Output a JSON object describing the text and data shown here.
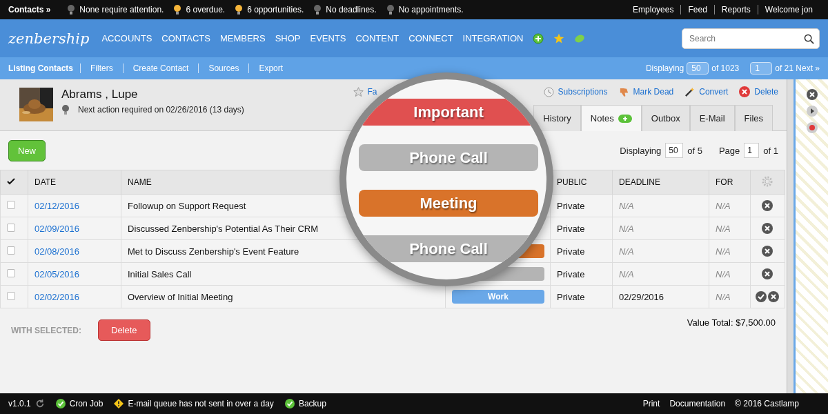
{
  "top_bar": {
    "title": "Contacts »",
    "notices": [
      {
        "text": "None require attention.",
        "lit": false
      },
      {
        "text": "6 overdue.",
        "lit": true
      },
      {
        "text": "6 opportunities.",
        "lit": true
      },
      {
        "text": "No deadlines.",
        "lit": false
      },
      {
        "text": "No appointments.",
        "lit": false
      }
    ],
    "links": [
      "Employees",
      "Feed",
      "Reports",
      "Welcome jon"
    ]
  },
  "nav": {
    "logo": "zenbership",
    "items": [
      "ACCOUNTS",
      "CONTACTS",
      "MEMBERS",
      "SHOP",
      "EVENTS",
      "CONTENT",
      "CONNECT",
      "INTEGRATION"
    ],
    "search": {
      "placeholder": "Search"
    }
  },
  "sub_bar": {
    "title": "Listing Contacts",
    "links": [
      "Filters",
      "Create Contact",
      "Sources",
      "Export"
    ],
    "displaying_label": "Displaying",
    "per_page": "50",
    "total": "of 1023",
    "page": "1",
    "pages": "of 21 Next »"
  },
  "contact": {
    "name": "Abrams , Lupe",
    "next_action": "Next action required on 02/26/2016 (13 days)",
    "actions": [
      {
        "kind": "star",
        "label": "Fa"
      },
      {
        "kind": "clock",
        "label": "Subscriptions"
      },
      {
        "kind": "thumb",
        "label": "Mark Dead"
      },
      {
        "kind": "wand",
        "label": "Convert"
      },
      {
        "kind": "delete",
        "label": "Delete"
      }
    ],
    "tabs": [
      {
        "label": "History",
        "selected": false
      },
      {
        "label": "Notes",
        "selected": true
      },
      {
        "label": "Outbox",
        "selected": false
      },
      {
        "label": "E-Mail",
        "selected": false
      },
      {
        "label": "Files",
        "selected": false
      }
    ]
  },
  "notes": {
    "new_button": "New",
    "displaying_label": "Displaying",
    "per_page": "50",
    "of_total": "of 5",
    "page_label": "Page",
    "page": "1",
    "of_pages": "of 1",
    "columns": [
      "DATE",
      "NAME",
      "PUBLIC",
      "DEADLINE",
      "FOR"
    ],
    "rows": [
      {
        "date": "02/12/2016",
        "name": "Followup on Support Request",
        "public": "Private",
        "deadline": "N/A",
        "for": "N/A",
        "checked": false,
        "done": false
      },
      {
        "date": "02/09/2016",
        "name": "Discussed Zenbership's Potential As Their CRM",
        "public": "Private",
        "deadline": "N/A",
        "for": "N/A",
        "checked": false,
        "done": false
      },
      {
        "date": "02/08/2016",
        "name": "Met to Discuss Zenbership's Event Feature",
        "tag": {
          "color": "#d9732a"
        },
        "public": "Private",
        "deadline": "N/A",
        "for": "N/A",
        "checked": false,
        "done": false
      },
      {
        "date": "02/05/2016",
        "name": "Initial Sales Call",
        "tag": {
          "color": "#b4b4b4"
        },
        "public": "Private",
        "deadline": "N/A",
        "for": "N/A",
        "checked": false,
        "done": false
      },
      {
        "date": "02/02/2016",
        "name": "Overview of Initial Meeting",
        "tag": {
          "label": "Work",
          "color": "#6aa8e8"
        },
        "public": "Private",
        "deadline": "02/29/2016",
        "for": "N/A",
        "checked": false,
        "done": true
      }
    ],
    "with_selected": "WITH SELECTED:",
    "delete_button": "Delete",
    "value_total": "Value Total: $7,500.00"
  },
  "magnifier": {
    "tags": [
      {
        "label": "Important",
        "color": "#e05050"
      },
      {
        "label": "Phone Call",
        "color": "#b4b4b4"
      },
      {
        "label": "Meeting",
        "color": "#d9732a"
      },
      {
        "label": "Phone Call",
        "color": "#b4b4b4"
      }
    ]
  },
  "footer": {
    "version": "v1.0.1",
    "statuses": [
      {
        "kind": "ok",
        "text": "Cron Job"
      },
      {
        "kind": "warn",
        "text": "E-mail queue has not sent in over a day"
      },
      {
        "kind": "ok",
        "text": "Backup"
      }
    ],
    "links": [
      "Print",
      "Documentation",
      "© 2016 Castlamp"
    ]
  }
}
